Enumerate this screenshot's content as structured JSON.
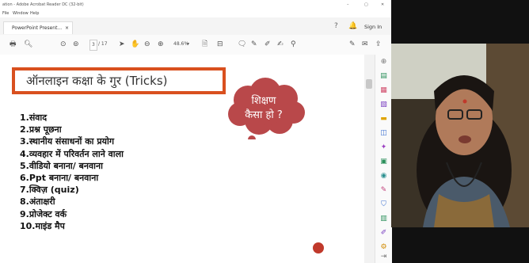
{
  "titlebar": {
    "text": "ation - Adobe Acrobat Reader DC (32-bit)",
    "controls": [
      "–",
      "▢",
      "✕"
    ]
  },
  "menubar": {
    "items": [
      "File",
      "Window",
      "Help"
    ]
  },
  "tabs": {
    "document_tab": "PowerPoint Present...",
    "sign_in": "Sign In"
  },
  "toolbar": {
    "page_current": "3",
    "page_total": "/ 17",
    "zoom": "48.6%"
  },
  "slide": {
    "title": "ऑनलाइन कक्षा के गुर (Tricks)",
    "cloud_line1": "शिक्षण",
    "cloud_line2": "कैसा हो ?",
    "items": [
      "1.संवाद",
      "2.प्रश्न पूछना",
      "3.स्थानीय संसाधनों का प्रयोग",
      "4.व्यवहार में परिवर्तन लाने वाला",
      "5.वीडियो बनाना/ बनवाना",
      "6.Ppt बनाना/ बनवाना",
      "7.क्विज़ (quiz)",
      "8.अंताक्षरी",
      "9.प्रोजेक्ट वर्क",
      "10.माइंड मैप"
    ]
  },
  "colors": {
    "title_border": "#d9501f",
    "cloud": "#b9484a",
    "accent_dot": "#c0392b"
  }
}
